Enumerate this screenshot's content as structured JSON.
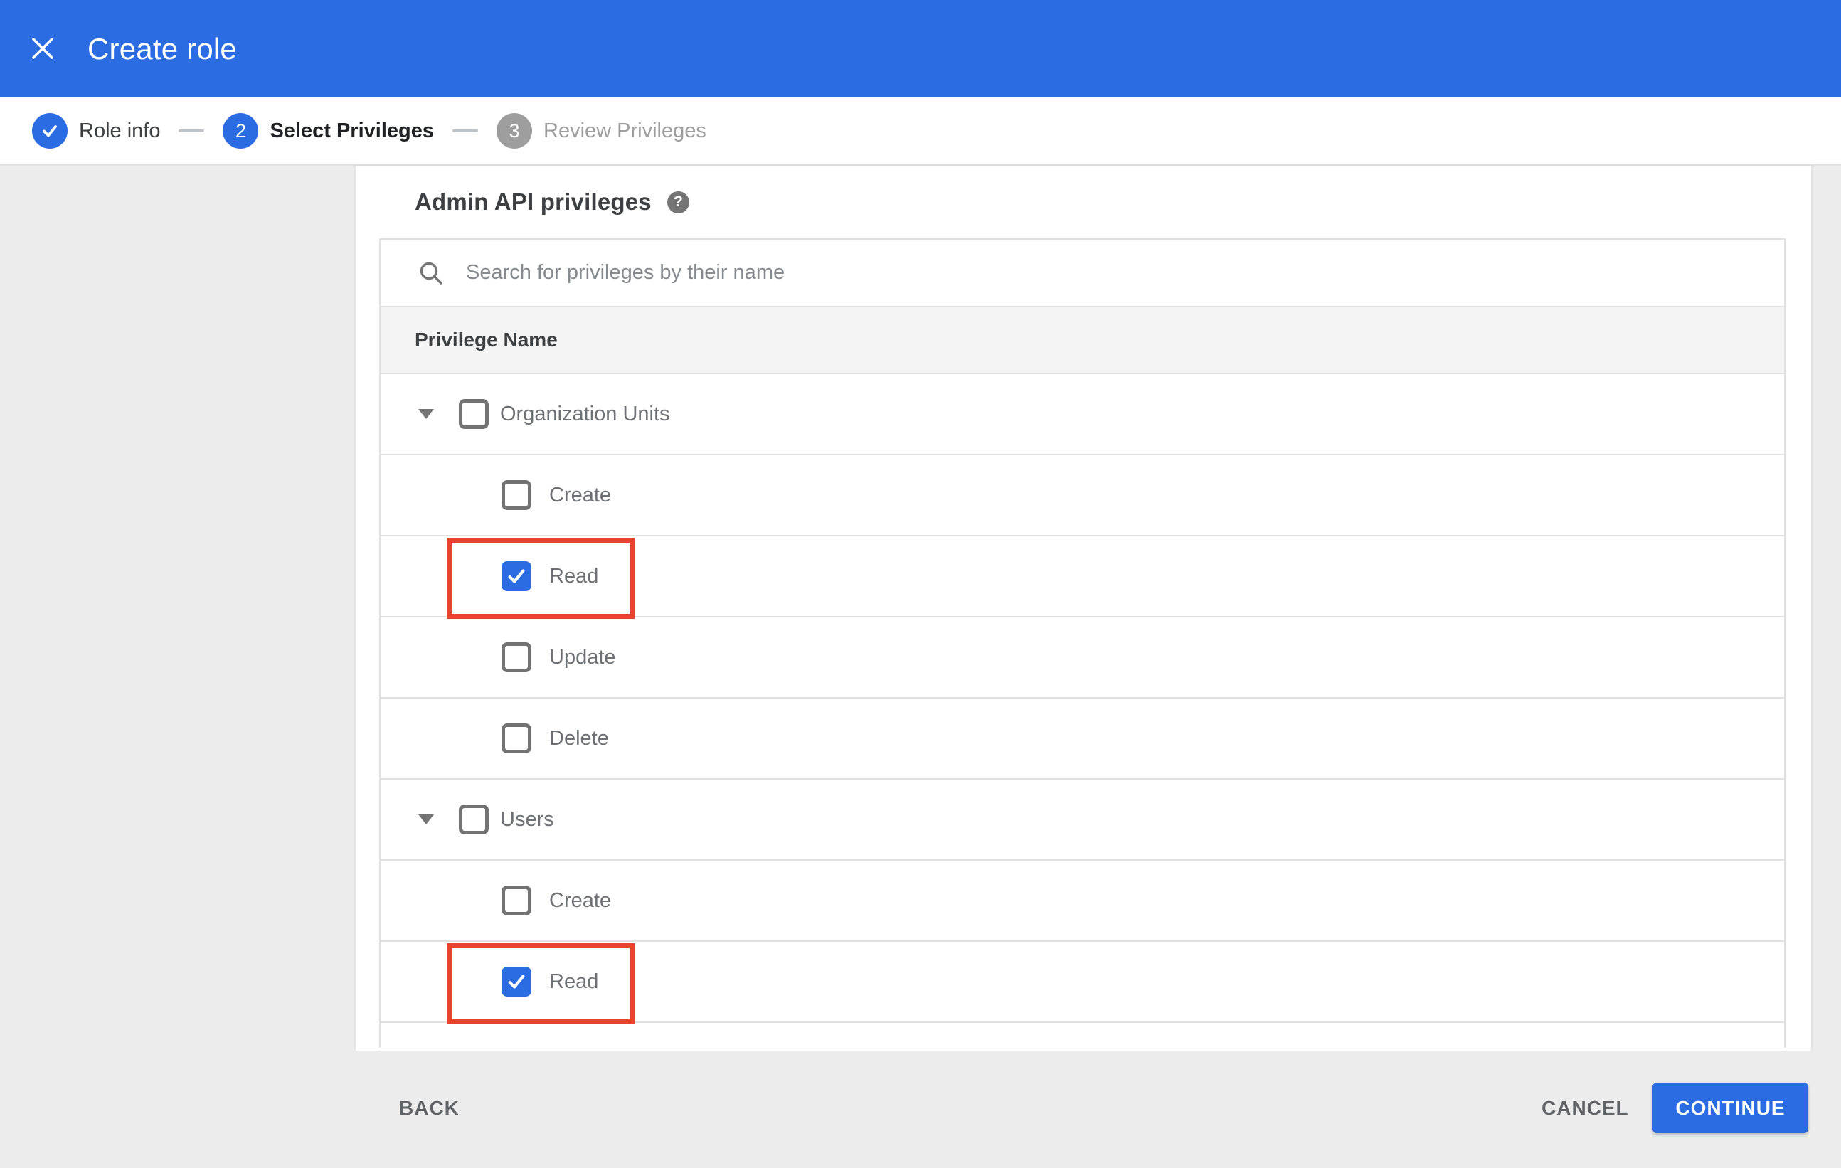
{
  "colors": {
    "primary_blue": "#2b6ce3",
    "page_background": "#ececec",
    "divider": "#e1e1e1",
    "header_row_background": "#f4f4f5",
    "highlight_red": "#e8432e",
    "icon_gray": "#757575",
    "muted_gray": "#9e9e9e"
  },
  "app_bar": {
    "title": "Create role",
    "close_icon": "close-icon"
  },
  "stepper": [
    {
      "label": "Role info",
      "state": "completed",
      "indicator": "check-icon"
    },
    {
      "label": "Select Privileges",
      "state": "active",
      "indicator": "2"
    },
    {
      "label": "Review Privileges",
      "state": "upcoming",
      "indicator": "3"
    }
  ],
  "privileges_panel": {
    "heading": "Admin API privileges",
    "help_icon": "?",
    "search": {
      "placeholder": "Search for privileges by their name",
      "value": "",
      "icon": "search-icon"
    },
    "column_header": "Privilege Name",
    "rows": [
      {
        "type": "group",
        "label": "Organization Units",
        "checked": false,
        "expanded": true,
        "highlighted": false
      },
      {
        "type": "child",
        "label": "Create",
        "checked": false,
        "highlighted": false
      },
      {
        "type": "child",
        "label": "Read",
        "checked": true,
        "highlighted": true
      },
      {
        "type": "child",
        "label": "Update",
        "checked": false,
        "highlighted": false
      },
      {
        "type": "child",
        "label": "Delete",
        "checked": false,
        "highlighted": false
      },
      {
        "type": "group",
        "label": "Users",
        "checked": false,
        "expanded": true,
        "highlighted": false
      },
      {
        "type": "child",
        "label": "Create",
        "checked": false,
        "highlighted": false
      },
      {
        "type": "child",
        "label": "Read",
        "checked": true,
        "highlighted": true
      }
    ]
  },
  "footer": {
    "back_label": "BACK",
    "cancel_label": "CANCEL",
    "continue_label": "CONTINUE"
  }
}
